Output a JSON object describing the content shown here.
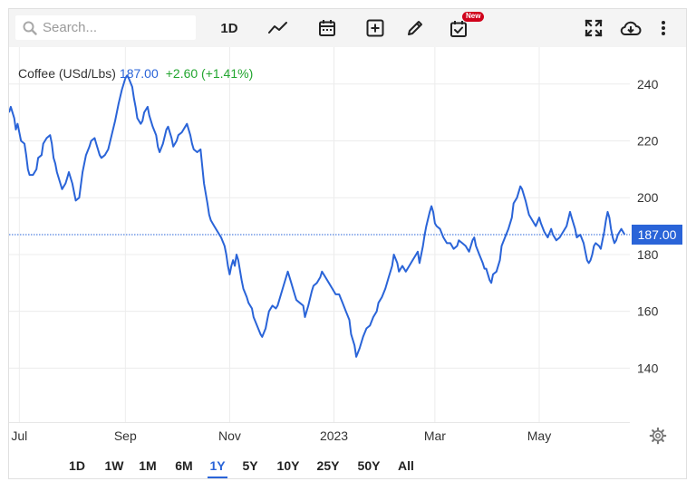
{
  "toolbar": {
    "search_placeholder": "Search...",
    "interval_label": "1D",
    "new_badge": "New",
    "icons": [
      "search-icon",
      "line-chart-icon",
      "calendar-icon",
      "add-icon",
      "pencil-icon",
      "calendar-check-icon",
      "fullscreen-icon",
      "cloud-download-icon",
      "more-vertical-icon"
    ]
  },
  "quote": {
    "name": "Coffee (USd/Lbs)",
    "price": "187.00",
    "change": "+2.60 (+1.41%)"
  },
  "price_tag": "187.00",
  "ranges": [
    "1D",
    "1W",
    "1M",
    "6M",
    "1Y",
    "5Y",
    "10Y",
    "25Y",
    "50Y",
    "All"
  ],
  "active_range": "1Y",
  "colors": {
    "line": "#2a64d8",
    "positive": "#22a52f",
    "grid": "#ececec",
    "active": "#2a64d8"
  },
  "chart_data": {
    "type": "line",
    "title": "Coffee (USd/Lbs)",
    "xlabel": "",
    "ylabel": "",
    "x_ticks": [
      {
        "label": "Jul",
        "x": 6
      },
      {
        "label": "Sep",
        "x": 68
      },
      {
        "label": "Nov",
        "x": 129
      },
      {
        "label": "2023",
        "x": 190
      },
      {
        "label": "Mar",
        "x": 249
      },
      {
        "label": "May",
        "x": 310
      }
    ],
    "y_ticks": [
      140,
      160,
      180,
      200,
      220,
      240
    ],
    "xlim": [
      0,
      363
    ],
    "ylim": [
      121,
      253
    ],
    "last_value": 187.0,
    "grid": true,
    "series": [
      {
        "points": [
          [
            0,
            230
          ],
          [
            1,
            232
          ],
          [
            3,
            228
          ],
          [
            4,
            224
          ],
          [
            5,
            226
          ],
          [
            6,
            223
          ],
          [
            7,
            220
          ],
          [
            9,
            219
          ],
          [
            10,
            215
          ],
          [
            11,
            210
          ],
          [
            12,
            208
          ],
          [
            14,
            208
          ],
          [
            16,
            210
          ],
          [
            17,
            214
          ],
          [
            19,
            215
          ],
          [
            20,
            219
          ],
          [
            22,
            221
          ],
          [
            24,
            222
          ],
          [
            25,
            219
          ],
          [
            26,
            214
          ],
          [
            27,
            212
          ],
          [
            28,
            209
          ],
          [
            30,
            205
          ],
          [
            31,
            203
          ],
          [
            33,
            205
          ],
          [
            34,
            207
          ],
          [
            35,
            209
          ],
          [
            37,
            205
          ],
          [
            38,
            202
          ],
          [
            39,
            199
          ],
          [
            41,
            200
          ],
          [
            43,
            209
          ],
          [
            45,
            215
          ],
          [
            47,
            218
          ],
          [
            48,
            220
          ],
          [
            50,
            221
          ],
          [
            51,
            219
          ],
          [
            53,
            215
          ],
          [
            54,
            214
          ],
          [
            56,
            215
          ],
          [
            58,
            217
          ],
          [
            60,
            222
          ],
          [
            62,
            227
          ],
          [
            64,
            233
          ],
          [
            66,
            238
          ],
          [
            68,
            242
          ],
          [
            69,
            243
          ],
          [
            70,
            242
          ],
          [
            72,
            239
          ],
          [
            73,
            235
          ],
          [
            74,
            232
          ],
          [
            75,
            228
          ],
          [
            77,
            226
          ],
          [
            78,
            227
          ],
          [
            79,
            230
          ],
          [
            81,
            232
          ],
          [
            82,
            229
          ],
          [
            84,
            225
          ],
          [
            86,
            222
          ],
          [
            87,
            218
          ],
          [
            88,
            216
          ],
          [
            90,
            219
          ],
          [
            92,
            224
          ],
          [
            93,
            225
          ],
          [
            95,
            221
          ],
          [
            96,
            218
          ],
          [
            98,
            220
          ],
          [
            99,
            222
          ],
          [
            101,
            223
          ],
          [
            103,
            225
          ],
          [
            104,
            226
          ],
          [
            106,
            222
          ],
          [
            107,
            219
          ],
          [
            108,
            217
          ],
          [
            110,
            216
          ],
          [
            112,
            217
          ],
          [
            113,
            211
          ],
          [
            114,
            205
          ],
          [
            116,
            198
          ],
          [
            117,
            194
          ],
          [
            118,
            192
          ],
          [
            120,
            190
          ],
          [
            122,
            188
          ],
          [
            124,
            186
          ],
          [
            126,
            183
          ],
          [
            127,
            180
          ],
          [
            128,
            176
          ],
          [
            129,
            173
          ],
          [
            130,
            176
          ],
          [
            131,
            178
          ],
          [
            132,
            176
          ],
          [
            133,
            180
          ],
          [
            134,
            178
          ],
          [
            136,
            171
          ],
          [
            137,
            168
          ],
          [
            139,
            165
          ],
          [
            140,
            163
          ],
          [
            142,
            161
          ],
          [
            143,
            158
          ],
          [
            145,
            155
          ],
          [
            147,
            152
          ],
          [
            148,
            151
          ],
          [
            150,
            154
          ],
          [
            151,
            157
          ],
          [
            152,
            160
          ],
          [
            154,
            162
          ],
          [
            156,
            161
          ],
          [
            157,
            162
          ],
          [
            158,
            164
          ],
          [
            160,
            168
          ],
          [
            162,
            172
          ],
          [
            163,
            174
          ],
          [
            165,
            170
          ],
          [
            167,
            166
          ],
          [
            168,
            164
          ],
          [
            170,
            163
          ],
          [
            172,
            162
          ],
          [
            173,
            158
          ],
          [
            175,
            162
          ],
          [
            177,
            167
          ],
          [
            178,
            169
          ],
          [
            180,
            170
          ],
          [
            182,
            172
          ],
          [
            183,
            174
          ],
          [
            185,
            172
          ],
          [
            187,
            170
          ],
          [
            189,
            168
          ],
          [
            191,
            166
          ],
          [
            193,
            166
          ],
          [
            195,
            163
          ],
          [
            197,
            160
          ],
          [
            199,
            157
          ],
          [
            200,
            152
          ],
          [
            202,
            148
          ],
          [
            203,
            144
          ],
          [
            205,
            147
          ],
          [
            207,
            151
          ],
          [
            209,
            154
          ],
          [
            211,
            155
          ],
          [
            213,
            158
          ],
          [
            215,
            160
          ],
          [
            216,
            163
          ],
          [
            218,
            165
          ],
          [
            220,
            168
          ],
          [
            222,
            172
          ],
          [
            224,
            176
          ],
          [
            225,
            180
          ],
          [
            227,
            177
          ],
          [
            228,
            174
          ],
          [
            230,
            176
          ],
          [
            232,
            174
          ],
          [
            234,
            176
          ],
          [
            236,
            178
          ],
          [
            238,
            180
          ],
          [
            239,
            181
          ],
          [
            240,
            177
          ],
          [
            241,
            180
          ],
          [
            242,
            183
          ],
          [
            243,
            187
          ],
          [
            244,
            190
          ],
          [
            246,
            195
          ],
          [
            247,
            197
          ],
          [
            248,
            195
          ],
          [
            249,
            191
          ],
          [
            250,
            190
          ],
          [
            252,
            189
          ],
          [
            254,
            186
          ],
          [
            256,
            184
          ],
          [
            258,
            184
          ],
          [
            260,
            182
          ],
          [
            262,
            183
          ],
          [
            263,
            185
          ],
          [
            265,
            184
          ],
          [
            267,
            183
          ],
          [
            268,
            182
          ],
          [
            269,
            181
          ],
          [
            271,
            185
          ],
          [
            272,
            186
          ],
          [
            273,
            183
          ],
          [
            275,
            180
          ],
          [
            277,
            177
          ],
          [
            278,
            175
          ],
          [
            279,
            175
          ],
          [
            280,
            173
          ],
          [
            281,
            171
          ],
          [
            282,
            170
          ],
          [
            283,
            173
          ],
          [
            285,
            174
          ],
          [
            287,
            178
          ],
          [
            288,
            183
          ],
          [
            290,
            186
          ],
          [
            292,
            189
          ],
          [
            294,
            193
          ],
          [
            295,
            198
          ],
          [
            297,
            200
          ],
          [
            299,
            204
          ],
          [
            300,
            203
          ],
          [
            302,
            199
          ],
          [
            304,
            194
          ],
          [
            306,
            192
          ],
          [
            308,
            190
          ],
          [
            310,
            193
          ],
          [
            311,
            191
          ],
          [
            313,
            188
          ],
          [
            315,
            186
          ],
          [
            317,
            189
          ],
          [
            318,
            187
          ],
          [
            320,
            185
          ],
          [
            322,
            186
          ],
          [
            324,
            188
          ],
          [
            326,
            190
          ],
          [
            328,
            195
          ],
          [
            329,
            193
          ],
          [
            331,
            189
          ],
          [
            332,
            186
          ],
          [
            334,
            187
          ],
          [
            336,
            184
          ],
          [
            337,
            181
          ],
          [
            338,
            178
          ],
          [
            339,
            177
          ],
          [
            340,
            178
          ],
          [
            341,
            180
          ],
          [
            342,
            183
          ],
          [
            343,
            184
          ],
          [
            345,
            183
          ],
          [
            346,
            182
          ],
          [
            347,
            185
          ],
          [
            348,
            188
          ],
          [
            349,
            192
          ],
          [
            350,
            195
          ],
          [
            351,
            193
          ],
          [
            352,
            189
          ],
          [
            353,
            186
          ],
          [
            354,
            184
          ],
          [
            355,
            185
          ],
          [
            356,
            187
          ],
          [
            358,
            189
          ],
          [
            360,
            187
          ]
        ]
      }
    ]
  }
}
